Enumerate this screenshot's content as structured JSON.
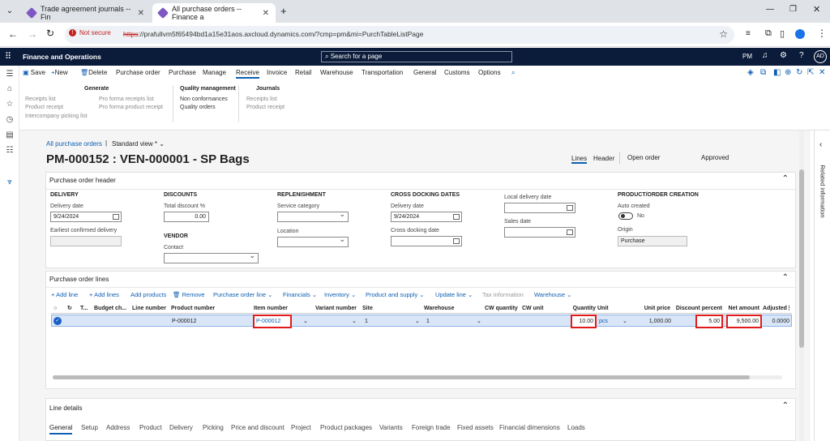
{
  "browser": {
    "tabs": [
      {
        "label": "Trade agreement journals -- Fin",
        "close": "✕"
      },
      {
        "label": "All purchase orders -- Finance a",
        "close": "✕"
      }
    ],
    "new_tab": "+",
    "not_secure": "Not secure",
    "url_scheme": "https",
    "url_rest": "://prafullvm5f65494bd1a15e31aos.axcloud.dynamics.com/?cmp=pm&mi=PurchTableListPage"
  },
  "app": {
    "title": "Finance and Operations",
    "search_placeholder": "Search for a page",
    "company": "PM",
    "user_initials": "AD"
  },
  "actionpane": {
    "save": "Save",
    "new": "New",
    "delete": "Delete",
    "menus": [
      "Purchase order",
      "Purchase",
      "Manage",
      "Receive",
      "Invoice",
      "Retail",
      "Warehouse",
      "Transportation",
      "General",
      "Customs",
      "Options"
    ],
    "generate": {
      "title": "Generate",
      "items": [
        "Receipts list",
        "Product receipt",
        "Intercompany picking list"
      ],
      "items2": [
        "Pro forma receipts list",
        "Pro forma product receipt"
      ]
    },
    "quality": {
      "title": "Quality management",
      "items": [
        "Non conformances",
        "Quality orders"
      ]
    },
    "journals": {
      "title": "Journals",
      "items": [
        "Receipts list",
        "Product receipt"
      ]
    }
  },
  "page": {
    "breadcrumb": "All purchase orders",
    "view": "Standard view *",
    "title": "PM-000152 : VEN-000001 - SP Bags",
    "view_lines": "Lines",
    "view_header": "Header",
    "status1": "Open order",
    "status2": "Approved"
  },
  "header_section": {
    "title": "Purchase order header",
    "delivery": {
      "title": "DELIVERY",
      "delivery_date_label": "Delivery date",
      "delivery_date": "9/24/2024",
      "earliest_label": "Earliest confirmed delivery",
      "earliest": ""
    },
    "discounts": {
      "title": "DISCOUNTS",
      "total_label": "Total discount %",
      "total": "0.00"
    },
    "vendor": {
      "title": "VENDOR",
      "contact_label": "Contact",
      "contact": ""
    },
    "replenishment": {
      "title": "REPLENISHMENT",
      "service_label": "Service category",
      "location_label": "Location"
    },
    "crossdock": {
      "title": "CROSS DOCKING DATES",
      "delivery_date_label": "Delivery date",
      "delivery_date": "9/24/2024",
      "crossdock_label": "Cross docking date"
    },
    "local": {
      "local_label": "Local delivery date",
      "sales_label": "Sales date"
    },
    "creation": {
      "title": "PRODUCT/ORDER CREATION",
      "auto_label": "Auto created",
      "auto_value": "No",
      "origin_label": "Origin",
      "origin": "Purchase"
    }
  },
  "lines_section": {
    "title": "Purchase order lines",
    "toolbar": [
      "Add line",
      "Add lines",
      "Add products",
      "Remove",
      "Purchase order line",
      "Financials",
      "Inventory",
      "Product and supply",
      "Update line",
      "Tax information",
      "Warehouse"
    ],
    "columns": [
      "T...",
      "Budget ch...",
      "Line number",
      "Product number",
      "Item number",
      "Variant number",
      "Site",
      "Warehouse",
      "CW quantity",
      "CW unit",
      "Quantity",
      "Unit",
      "Unit price",
      "Discount percent",
      "Net amount",
      "Adjusted..."
    ],
    "row": {
      "product_number": "P-000012",
      "item_number": "P-000012",
      "site": "1",
      "warehouse": "1",
      "quantity": "10.00",
      "unit": "pcs",
      "unit_price": "1,000.00",
      "discount": "5.00",
      "net_amount": "9,500.00",
      "adjusted": "0.0000"
    }
  },
  "line_details": {
    "title": "Line details",
    "tabs": [
      "General",
      "Setup",
      "Address",
      "Product",
      "Delivery",
      "Picking",
      "Price and discount",
      "Project",
      "Product packages",
      "Variants",
      "Foreign trade",
      "Fixed assets",
      "Financial dimensions",
      "Loads"
    ]
  },
  "right_panel": {
    "label": "Related information"
  },
  "colors": {
    "header_bg": "#0b1b3a",
    "link": "#0f5fb3",
    "highlight": "#e01b1b"
  }
}
